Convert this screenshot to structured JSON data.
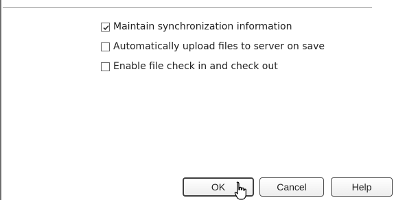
{
  "options": [
    {
      "label": "Maintain synchronization information",
      "checked": true
    },
    {
      "label": "Automatically upload files to server on save",
      "checked": false
    },
    {
      "label": "Enable file check in and check out",
      "checked": false
    }
  ],
  "buttons": {
    "ok": "OK",
    "cancel": "Cancel",
    "help": "Help"
  }
}
